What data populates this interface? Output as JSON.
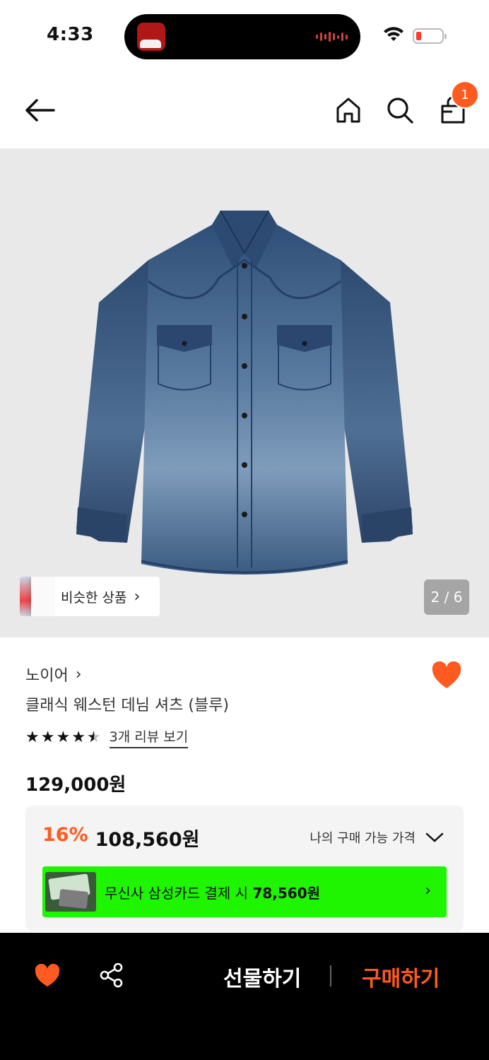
{
  "status_bar": {
    "time": "4:33"
  },
  "nav": {
    "cart_count": "1"
  },
  "gallery": {
    "similar_label": "비슷한 상품",
    "counter": "2 / 6"
  },
  "product": {
    "brand": "노이어",
    "name": "클래식 웨스턴 데님 셔츠 (블루)",
    "rating": 4.5,
    "review_link": "3개 리뷰 보기",
    "original_price": "129,000원"
  },
  "price_box": {
    "discount_pct": "16%",
    "sale_price": "108,560원",
    "my_price_label": "나의 구매 가능 가격",
    "card_text": "무신사 삼성카드 결제 시",
    "card_price": "78,560원"
  },
  "bottom_bar": {
    "gift_label": "선물하기",
    "buy_label": "구매하기"
  },
  "colors": {
    "accent": "#ff5a1f",
    "banner_green": "#1ff500"
  }
}
